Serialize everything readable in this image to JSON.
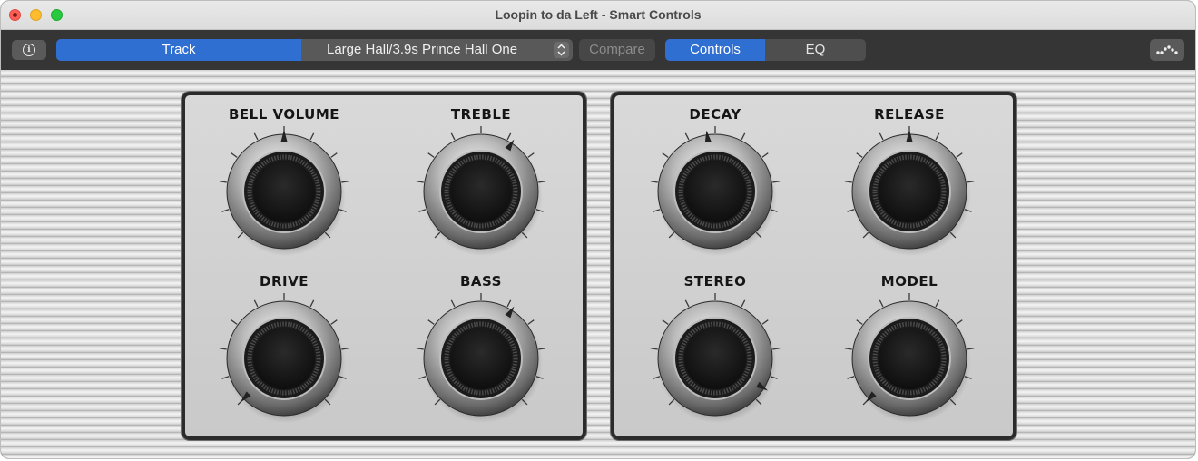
{
  "window": {
    "title": "Loopin to da Left - Smart Controls"
  },
  "toolbar": {
    "info_icon": "info-icon",
    "track_label": "Track",
    "preset_label": "Large Hall/3.9s Prince Hall One",
    "compare_label": "Compare",
    "controls_label": "Controls",
    "eq_label": "EQ",
    "automation_icon": "automation-icon"
  },
  "knobs": [
    {
      "id": "bell-volume",
      "label": "BELL VOLUME",
      "value": 0.5
    },
    {
      "id": "treble",
      "label": "TREBLE",
      "value": 0.62
    },
    {
      "id": "drive",
      "label": "DRIVE",
      "value": 0.0
    },
    {
      "id": "bass",
      "label": "BASS",
      "value": 0.62
    },
    {
      "id": "decay",
      "label": "DECAY",
      "value": 0.47
    },
    {
      "id": "release",
      "label": "RELEASE",
      "value": 0.5
    },
    {
      "id": "stereo",
      "label": "STEREO",
      "value": 0.95
    },
    {
      "id": "model",
      "label": "MODEL",
      "value": 0.0
    }
  ],
  "colors": {
    "accent": "#2f6fd1",
    "panel_border": "#2b2b2b"
  }
}
